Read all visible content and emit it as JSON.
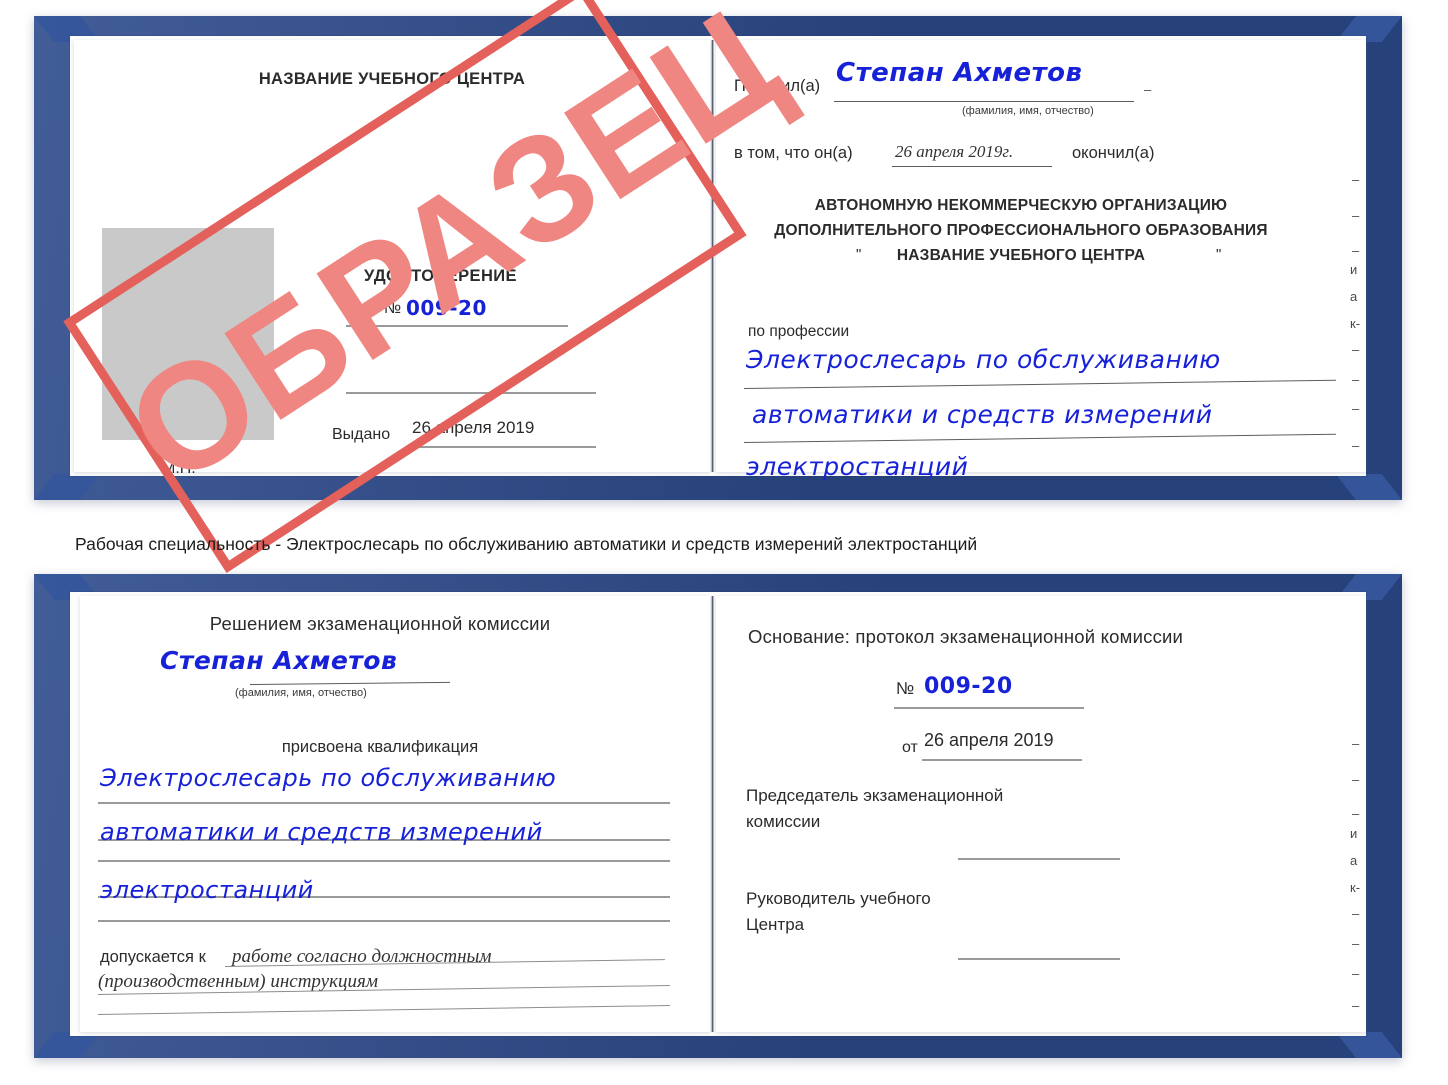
{
  "caption": "Рабочая специальность - Электрослесарь по обслуживанию автоматики и средств измерений электростанций",
  "watermark": {
    "text": "ОБРАЗЕЦ",
    "color": "#ef8681",
    "frame_color": "#e4605b"
  },
  "colors": {
    "binding_blue": "#2c4a8b",
    "handwriting_blue": "#1722d8",
    "paper_white": "#ffffff",
    "photo_placeholder_gray": "#c9c9c9",
    "rule_gray": "#9a9a9a"
  },
  "certificate_front": {
    "left_page": {
      "center_name": "НАЗВАНИЕ УЧЕБНОГО ЦЕНТРА",
      "title": "УДОСТОВЕРЕНИЕ",
      "number_label": "№",
      "number_value": "009-20",
      "issued_label": "Выдано",
      "issued_value": "26 апреля 2019",
      "stamp_label": "М.П.",
      "photo_placeholder": ""
    },
    "right_page": {
      "received_label": "Получил(а)",
      "received_value": "Степан Ахметов",
      "fio_hint": "(фамилия, имя, отчество)",
      "that_he_label": "в том, что он(а)",
      "completed_date": "26 апреля 2019г.",
      "finished_label": "окончил(а)",
      "org_line1": "АВТОНОМНУЮ НЕКОММЕРЧЕСКУЮ ОРГАНИЗАЦИЮ",
      "org_line2": "ДОПОЛНИТЕЛЬНОГО ПРОФЕССИОНАЛЬНОГО ОБРАЗОВАНИЯ",
      "org_quote_open": "\"",
      "org_line3": "НАЗВАНИЕ УЧЕБНОГО ЦЕНТРА",
      "org_quote_close": "\"",
      "profession_label": "по профессии",
      "profession_line1": "Электрослесарь по обслуживанию",
      "profession_line2": "автоматики и средств измерений",
      "profession_line3": "электростанций",
      "edge_fragments": [
        "–",
        "–",
        "–",
        "и",
        "а",
        "к-",
        "–",
        "–",
        "–",
        "–"
      ]
    }
  },
  "certificate_back": {
    "left_page": {
      "heading": "Решением экзаменационной комиссии",
      "name_value": "Степан Ахметов",
      "fio_hint": "(фамилия, имя, отчество)",
      "qualification_label": "присвоена квалификация",
      "qualification_line1": "Электрослесарь по обслуживанию",
      "qualification_line2": "автоматики и средств измерений",
      "qualification_line3": "электростанций",
      "admitted_label": "допускается к",
      "admitted_value_line1": "работе согласно должностным",
      "admitted_value_line2": "(производственным) инструкциям"
    },
    "right_page": {
      "basis_label": "Основание: протокол экзаменационной комиссии",
      "number_label": "№",
      "number_value": "009-20",
      "date_label": "от",
      "date_value": "26 апреля 2019",
      "chairman_line1": "Председатель экзаменационной",
      "chairman_line2": "комиссии",
      "head_line1": "Руководитель учебного",
      "head_line2": "Центра",
      "edge_fragments": [
        "–",
        "–",
        "–",
        "и",
        "а",
        "к-",
        "–",
        "–",
        "–",
        "–"
      ]
    }
  }
}
